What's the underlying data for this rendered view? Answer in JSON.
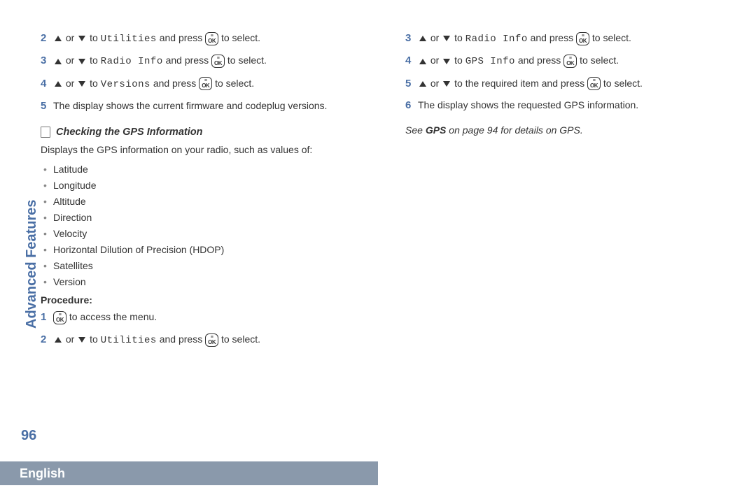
{
  "side_label": "Advanced Features",
  "page_number": "96",
  "language": "English",
  "or": "or",
  "to": "to",
  "and_press": "and press",
  "to_select": "to select.",
  "to_access": "to access the menu.",
  "menu_utilities": "Utilities",
  "menu_radio_info": "Radio Info",
  "menu_versions": "Versions",
  "menu_gps_info": "GPS Info",
  "left": {
    "step2_num": "2",
    "step3_num": "3",
    "step4_num": "4",
    "step5_num": "5",
    "step5_text": "The display shows the current firmware and codeplug versions.",
    "section_title": "Checking the GPS Information",
    "intro": "Displays the GPS information on your radio, such as values of:",
    "bullets": [
      "Latitude",
      "Longitude",
      "Altitude",
      "Direction",
      "Velocity",
      "Horizontal Dilution of Precision (HDOP)",
      "Satellites",
      "Version"
    ],
    "procedure_label": "Procedure:",
    "p_step1_num": "1",
    "p_step2_num": "2"
  },
  "right": {
    "step3_num": "3",
    "step4_num": "4",
    "step5_num": "5",
    "step5_text_a": "to the required item and press",
    "step6_num": "6",
    "step6_text": "The display shows the requested GPS information.",
    "footnote_pre": "See ",
    "footnote_bold": "GPS",
    "footnote_post": " on page 94 for details on GPS."
  }
}
